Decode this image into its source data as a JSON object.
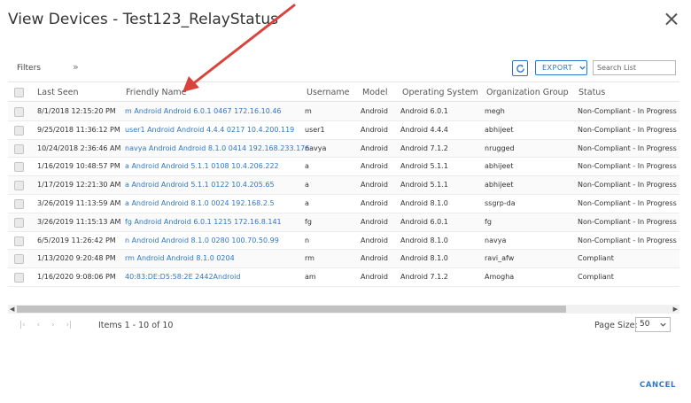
{
  "dialog": {
    "title": "View Devices - Test123_RelayStatus"
  },
  "toolbar": {
    "filters_label": "Filters",
    "filters_chevron": "»",
    "export_label": "EXPORT",
    "search_placeholder": "Search List"
  },
  "table": {
    "columns": [
      "Last Seen",
      "Friendly Name",
      "Username",
      "Model",
      "Operating System",
      "Organization Group",
      "Status"
    ],
    "rows": [
      {
        "last_seen": "8/1/2018 12:15:20 PM",
        "friendly_name": "m Android Android 6.0.1 0467 172.16.10.46",
        "username": "m",
        "model": "Android",
        "os": "Android 6.0.1",
        "org_group": "megh",
        "status": "Non-Compliant - In Progress"
      },
      {
        "last_seen": "9/25/2018 11:36:12 PM",
        "friendly_name": "user1 Android Android 4.4.4 0217 10.4.200.119",
        "username": "user1",
        "model": "Android",
        "os": "Android 4.4.4",
        "org_group": "abhijeet",
        "status": "Non-Compliant - In Progress"
      },
      {
        "last_seen": "10/24/2018 2:36:46 AM",
        "friendly_name": "navya Android Android 8.1.0 0414 192.168.233.176",
        "username": "navya",
        "model": "Android",
        "os": "Android 7.1.2",
        "org_group": "nrugged",
        "status": "Non-Compliant - In Progress"
      },
      {
        "last_seen": "1/16/2019 10:48:57 PM",
        "friendly_name": "a Android Android 5.1.1 0108 10.4.206.222",
        "username": "a",
        "model": "Android",
        "os": "Android 5.1.1",
        "org_group": "abhijeet",
        "status": "Non-Compliant - In Progress"
      },
      {
        "last_seen": "1/17/2019 12:21:30 AM",
        "friendly_name": "a Android Android 5.1.1 0122 10.4.205.65",
        "username": "a",
        "model": "Android",
        "os": "Android 5.1.1",
        "org_group": "abhijeet",
        "status": "Non-Compliant - In Progress"
      },
      {
        "last_seen": "3/26/2019 11:13:59 AM",
        "friendly_name": "a Android Android 8.1.0 0024 192.168.2.5",
        "username": "a",
        "model": "Android",
        "os": "Android 8.1.0",
        "org_group": "ssgrp-da",
        "status": "Non-Compliant - In Progress"
      },
      {
        "last_seen": "3/26/2019 11:15:13 AM",
        "friendly_name": "fg Android Android 6.0.1 1215 172.16.8.141",
        "username": "fg",
        "model": "Android",
        "os": "Android 6.0.1",
        "org_group": "fg",
        "status": "Non-Compliant - In Progress"
      },
      {
        "last_seen": "6/5/2019 11:26:42 PM",
        "friendly_name": "n Android Android 8.1.0 0280 100.70.50.99",
        "username": "n",
        "model": "Android",
        "os": "Android 8.1.0",
        "org_group": "navya",
        "status": "Non-Compliant - In Progress"
      },
      {
        "last_seen": "1/13/2020 9:20:48 PM",
        "friendly_name": "rm Android Android 8.1.0 0204",
        "username": "rm",
        "model": "Android",
        "os": "Android 8.1.0",
        "org_group": "ravi_afw",
        "status": "Compliant"
      },
      {
        "last_seen": "1/16/2020 9:08:06 PM",
        "friendly_name": "40:83:DE:D5:58:2E 2442Android",
        "username": "am",
        "model": "Android",
        "os": "Android 7.1.2",
        "org_group": "Amogha",
        "status": "Compliant"
      }
    ]
  },
  "pagination": {
    "first": "|‹",
    "prev": "‹",
    "next": "›",
    "last": "›|",
    "items_text": "Items 1 - 10 of 10",
    "page_size_label": "Page Size:",
    "page_size_value": "50"
  },
  "footer": {
    "cancel_label": "CANCEL"
  },
  "colors": {
    "accent": "#2f77c4",
    "annotation_arrow": "#d9433b"
  }
}
